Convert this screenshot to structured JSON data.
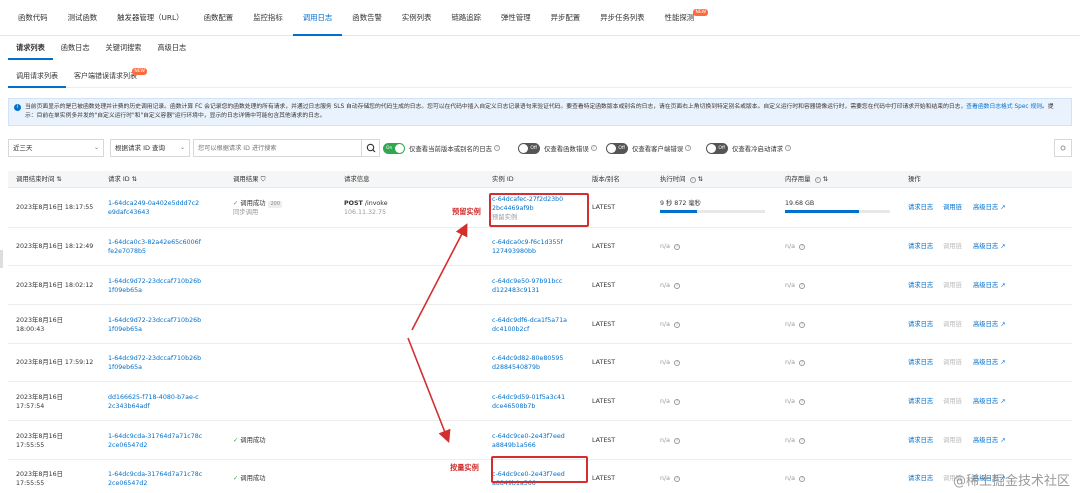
{
  "topnav": {
    "items": [
      "函数代码",
      "测试函数",
      "触发器管理（URL）",
      "函数配置",
      "监控指标",
      "调用日志",
      "函数告警",
      "实例列表",
      "链路追踪",
      "弹性管理",
      "异步配置",
      "异步任务列表",
      "性能探测"
    ],
    "new_badge": "NEW"
  },
  "subnav": {
    "items": [
      "请求列表",
      "函数日志",
      "关键词搜索",
      "高级日志"
    ]
  },
  "tabs3": {
    "items": [
      "调用请求列表",
      "客户端错误请求列表"
    ],
    "new_badge": "NEW"
  },
  "notice": {
    "text": "当前页面显示的是已被函数处理并计费的历史调用记录。函数计算 FC 会记录您的函数处理的所有请求，并通过日志服务 SLS 自动存储您的代码生成的日志。您可以在代码中插入自定义日志记录语句来验证代码。要查看特定函数版本或别名的日志，请在页面右上角切换到特定别名或版本。自定义运行时和容器镜像运行时，需要您在代码中打印请求开始和结束的日志，",
    "link": "查看函数日志格式 Spec 规则",
    "tail": "。提示：目前在单实例多并发的\"自定义运行时\"和\"自定义容器\"运行环境中，显示的日志详情中可能包含其他请求的日志。"
  },
  "filters": {
    "time_range": "近三天",
    "query_type": "根据请求 ID 查询",
    "search_placeholder": "您可以根据请求 ID 进行搜索",
    "toggle_version": {
      "state": "On",
      "label": "仅查看当前版本或别名的日志"
    },
    "toggle_func_err": {
      "state": "Off",
      "label": "仅查看函数错误"
    },
    "toggle_client_err": {
      "state": "Off",
      "label": "仅查看客户端错误"
    },
    "toggle_cold": {
      "state": "Off",
      "label": "仅查看冷启动请求"
    }
  },
  "table": {
    "headers": {
      "end_time": "调用结束时间",
      "request_id": "请求 ID",
      "result": "调用结果",
      "request_info": "请求信息",
      "instance_id": "实例 ID",
      "version": "版本/别名",
      "exec_time": "执行时间",
      "memory": "内存用量",
      "actions": "操作"
    },
    "rows": [
      {
        "time": "2023年8月16日 18:17:55",
        "rid1": "1-64dca249-0a402e5ddd7c2",
        "rid2": "e9dafc43643",
        "result": "调用成功",
        "code": "200",
        "result2": "同步调用",
        "method": "POST",
        "path": "/invoke",
        "ip": "106.11.32.75",
        "iid1": "c-64dcafec-27f2d23b0",
        "iid2": "2bc4469af9b",
        "iid3": "预留实例",
        "version": "LATEST",
        "exec": "9 秒 872 毫秒",
        "exec_frac": 0.35,
        "mem": "19.68 GB",
        "mem_frac": 0.7,
        "log": "请求日志",
        "mirror": "调用链",
        "adv": "高级日志"
      },
      {
        "time": "2023年8月16日 18:12:49",
        "rid1": "1-64dca0c3-82a42e65c6006f",
        "rid2": "fe2e7078b5",
        "iid1": "c-64dca0c9-f6c1d355f",
        "iid2": "127493980bb",
        "version": "LATEST",
        "exec": "n/a",
        "mem": "n/a",
        "log": "请求日志",
        "mirror": "调用链",
        "adv": "高级日志"
      },
      {
        "time": "2023年8月16日 18:02:12",
        "rid1": "1-64dc9d72-23dccaf710b26b",
        "rid2": "1f09eb65a",
        "iid1": "c-64dc9e50-97b91bcc",
        "iid2": "d122483c9131",
        "version": "LATEST",
        "exec": "n/a",
        "mem": "n/a",
        "log": "请求日志",
        "mirror": "调用链",
        "adv": "高级日志"
      },
      {
        "time": "2023年8月16日",
        "time2": "18:00:43",
        "rid1": "1-64dc9d72-23dccaf710b26b",
        "rid2": "1f09eb65a",
        "iid1": "c-64dc9df6-dca1f5a71a",
        "iid2": "dc4100b2cf",
        "version": "LATEST",
        "exec": "n/a",
        "mem": "n/a",
        "log": "请求日志",
        "mirror": "调用链",
        "adv": "高级日志"
      },
      {
        "time": "2023年8月16日 17:59:12",
        "rid1": "1-64dc9d72-23dccaf710b26b",
        "rid2": "1f09eb65a",
        "iid1": "c-64dc9d82-80e80595",
        "iid2": "d2884540879b",
        "version": "LATEST",
        "exec": "n/a",
        "mem": "n/a",
        "log": "请求日志",
        "mirror": "调用链",
        "adv": "高级日志"
      },
      {
        "time": "2023年8月16日",
        "time2": "17:57:54",
        "rid1": "dd166625-f718-4080-b7ae-c",
        "rid2": "2c343b64adf",
        "iid1": "c-64dc9d59-01f5a3c41",
        "iid2": "dce46508b7b",
        "version": "LATEST",
        "exec": "n/a",
        "mem": "n/a",
        "log": "请求日志",
        "mirror": "调用链",
        "adv": "高级日志"
      },
      {
        "time": "2023年8月16日",
        "time2": "17:55:55",
        "rid1": "1-64dc9cda-31764d7a71c78c",
        "rid2": "2ce06547d2",
        "result": "调用成功",
        "iid1": "c-64dc9ce0-2e43f7eed",
        "iid2": "a8849b1a566",
        "version": "LATEST",
        "exec": "n/a",
        "mem": "n/a",
        "log": "请求日志",
        "mirror": "调用链",
        "adv": "高级日志"
      },
      {
        "time": "2023年8月16日",
        "time2": "17:55:55",
        "rid1": "1-64dc9cda-31764d7a71c78c",
        "rid2": "2ce06547d2",
        "result": "调用成功",
        "iid1": "c-64dc9ce0-2e43f7eed",
        "iid2": "a8849b1a566",
        "version": "LATEST",
        "exec": "n/a",
        "mem": "n/a",
        "log": "请求日志",
        "mirror": "调用链",
        "adv": "高级日志"
      }
    ]
  },
  "annotations": {
    "reserved": "预留实例",
    "on_demand": "按量实例"
  },
  "watermark": "@稀土掘金技术社区",
  "colors": {
    "accent": "#0070cc",
    "success": "#2fa84f",
    "annotation": "#d32f2f"
  }
}
